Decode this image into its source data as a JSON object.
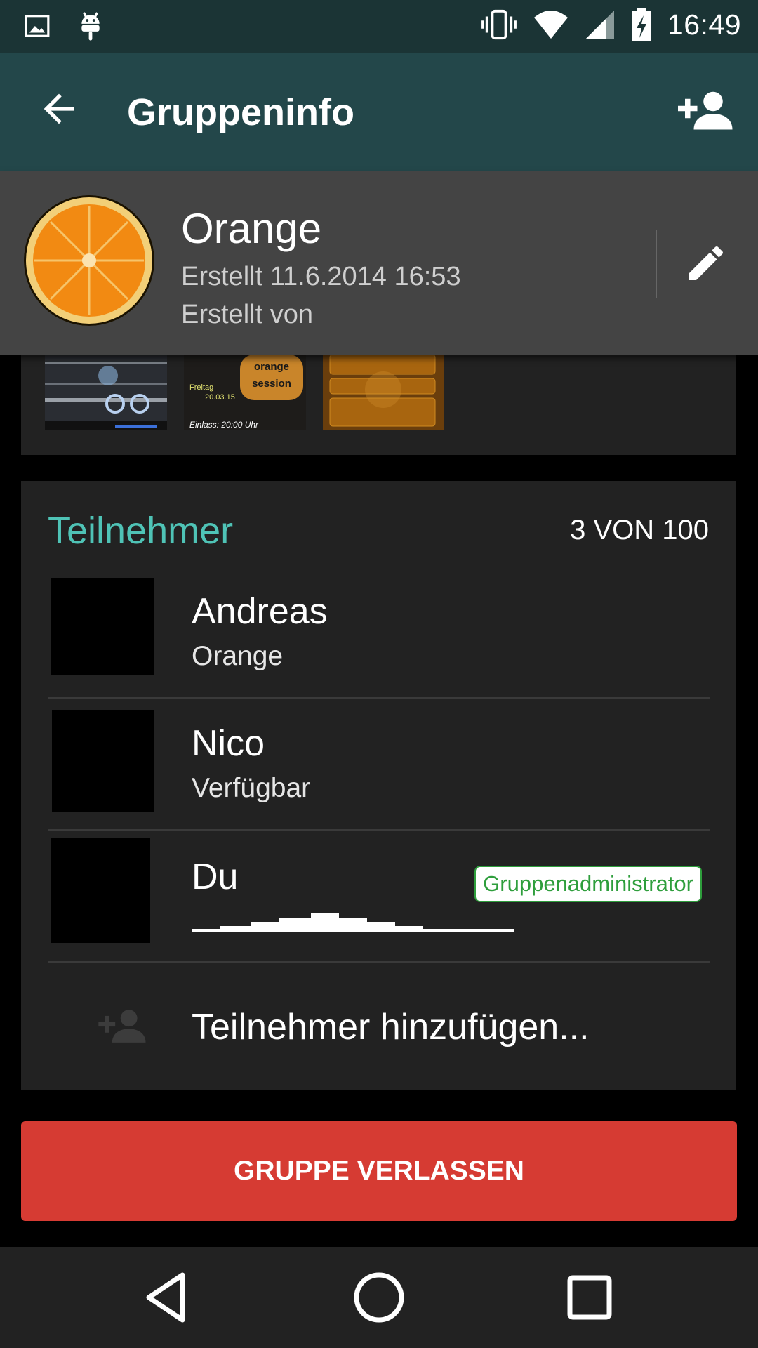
{
  "status_bar": {
    "time": "16:49",
    "left_icons": [
      "image-icon",
      "android-icon"
    ],
    "right_icons": [
      "vibrate-icon",
      "wifi-icon",
      "signal-icon",
      "battery-charging-icon"
    ]
  },
  "app_bar": {
    "title": "Gruppeninfo",
    "back_icon": "arrow-back-icon",
    "add_icon": "person-add-icon"
  },
  "group": {
    "name": "Orange",
    "created": "Erstellt 11.6.2014 16:53",
    "created_by": "Erstellt von",
    "edit_icon": "pencil-icon"
  },
  "media": {
    "thumbnails": [
      "media-thumb-1",
      "media-thumb-2",
      "media-thumb-3"
    ],
    "thumb2_text": {
      "top": "orange",
      "middle": "session",
      "date": "20.03.15",
      "day": "Freitag",
      "bottom": "Einlass: 20:00 Uhr"
    }
  },
  "participants": {
    "title": "Teilnehmer",
    "count": "3 VON 100",
    "members": [
      {
        "name": "Andreas",
        "status": "Orange"
      },
      {
        "name": "Nico",
        "status": "Verfügbar"
      },
      {
        "name": "Du",
        "status": "",
        "badge": "Gruppenadministrator"
      }
    ],
    "add_label": "Teilnehmer hinzufügen..."
  },
  "leave_button": {
    "label": "GRUPPE VERLASSEN"
  },
  "nav": [
    "back-nav",
    "home-nav",
    "recents-nav"
  ],
  "colors": {
    "status_bar": "#1b3435",
    "app_bar": "#23474a",
    "accent": "#4fc3b6",
    "leave": "#d63b33",
    "admin": "#2e9e3c"
  }
}
